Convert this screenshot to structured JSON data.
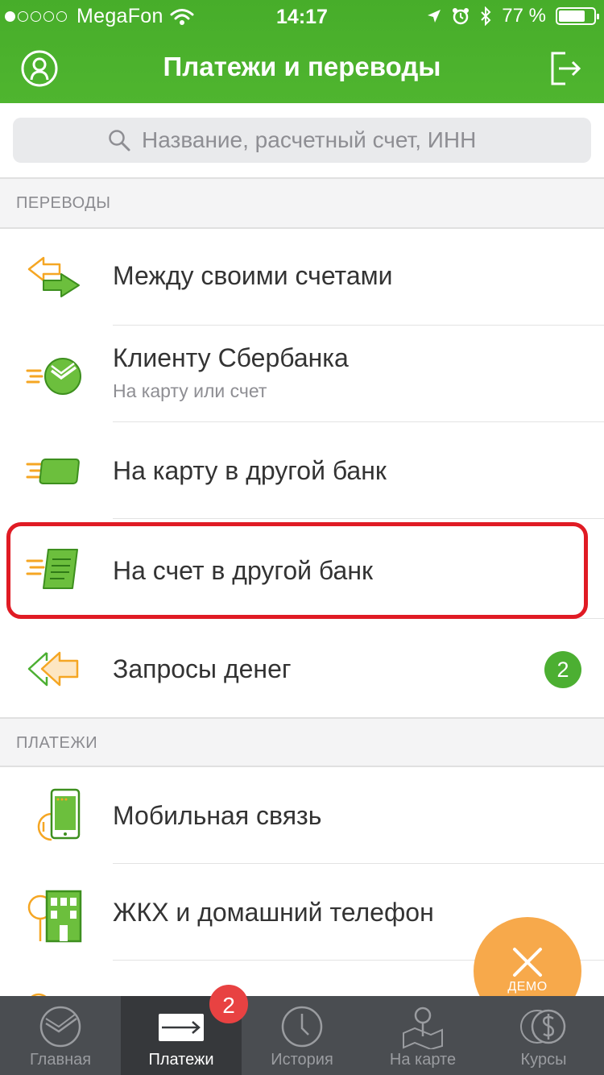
{
  "statusbar": {
    "carrier": "MegaFon",
    "time": "14:17",
    "battery": "77 %",
    "battery_level": 0.77,
    "signal_dots_filled": 1,
    "signal_dots_total": 5
  },
  "header": {
    "title": "Платежи и переводы",
    "profile_icon": "profile-icon",
    "exit_icon": "exit-icon"
  },
  "search": {
    "placeholder": "Название, расчетный счет, ИНН"
  },
  "sections": {
    "transfers": "ПЕРЕВОДЫ",
    "payments": "ПЛАТЕЖИ"
  },
  "transfers": [
    {
      "label": "Между своими счетами",
      "sub": ""
    },
    {
      "label": "Клиенту Сбербанка",
      "sub": "На карту или счет"
    },
    {
      "label": "На карту в другой банк",
      "sub": ""
    },
    {
      "label": "На счет в другой банк",
      "sub": ""
    },
    {
      "label": "Запросы денег",
      "sub": "",
      "badge": "2"
    }
  ],
  "payments": [
    {
      "label": "Мобильная связь"
    },
    {
      "label": "ЖКХ и домашний телефон"
    }
  ],
  "demo": {
    "label": "ДЕМО"
  },
  "tabs": [
    {
      "label": "Главная"
    },
    {
      "label": "Платежи",
      "badge": "2"
    },
    {
      "label": "История"
    },
    {
      "label": "На карте"
    },
    {
      "label": "Курсы"
    }
  ],
  "colors": {
    "header_green": "#4fb52f",
    "accent_green": "#4caf32",
    "highlight_red": "#e01b24",
    "demo_orange": "#f7a94b",
    "tabbar": "#4a4d51"
  }
}
